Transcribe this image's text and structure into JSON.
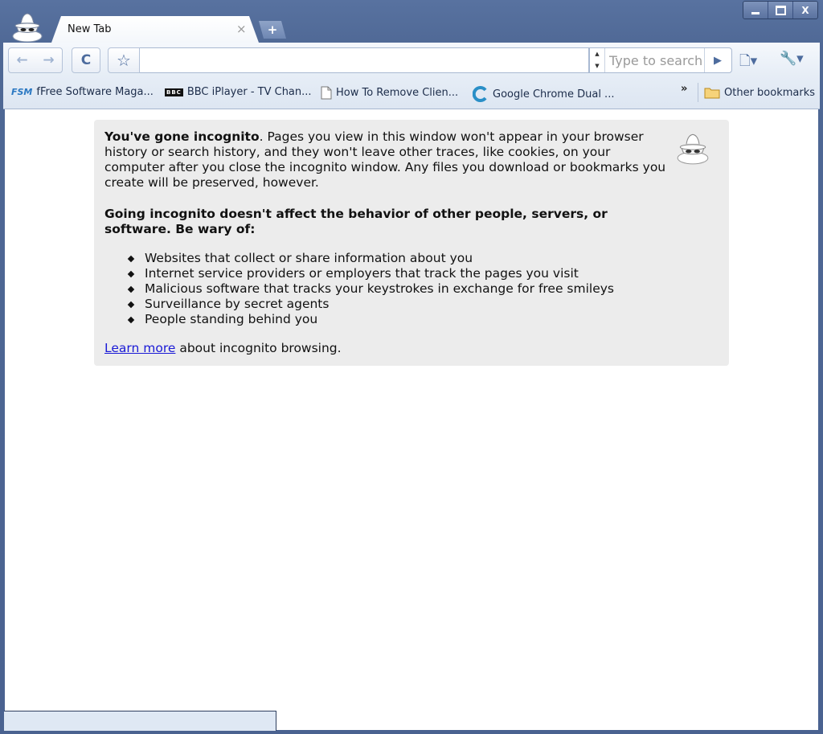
{
  "window": {
    "controls": {
      "minimize": "",
      "maximize": "",
      "close": "X"
    }
  },
  "tab": {
    "title": "New Tab",
    "close": "×",
    "new_tab": "+"
  },
  "toolbar": {
    "back": "←",
    "forward": "→",
    "reload": "C",
    "star": "☆",
    "omnibox_value": "",
    "search_placeholder": "Type to search",
    "search_go": "▶",
    "page_menu": "🗋▾",
    "tools_menu": "🔧▾"
  },
  "bookmarks": {
    "items": [
      {
        "icon": "FSM",
        "label": "fFree Software Maga..."
      },
      {
        "icon": "BBC",
        "label": "BBC iPlayer - TV Chan..."
      },
      {
        "icon": "page",
        "label": "How To Remove Clien..."
      },
      {
        "icon": "chrome",
        "label": "Google Chrome Dual ..."
      }
    ],
    "overflow": "»",
    "other": "Other bookmarks"
  },
  "incognito": {
    "heading_bold": "You've gone incognito",
    "intro_rest": ". Pages you view in this window won't appear in your browser history or search history, and they won't leave other traces, like cookies, on your computer after you close the incognito window. Any files you download or bookmarks you create will be preserved, however.",
    "warning": "Going incognito doesn't affect the behavior of other people, servers, or software. Be wary of:",
    "list": [
      "Websites that collect or share information about you",
      "Internet service providers or employers that track the pages you visit",
      "Malicious software that tracks your keystrokes in exchange for free smileys",
      "Surveillance by secret agents",
      "People standing behind you"
    ],
    "learn_more_link": "Learn more",
    "learn_more_rest": " about incognito browsing."
  },
  "colors": {
    "frame": "#4a6290",
    "card": "#ececec",
    "link": "#1a1ad6"
  }
}
